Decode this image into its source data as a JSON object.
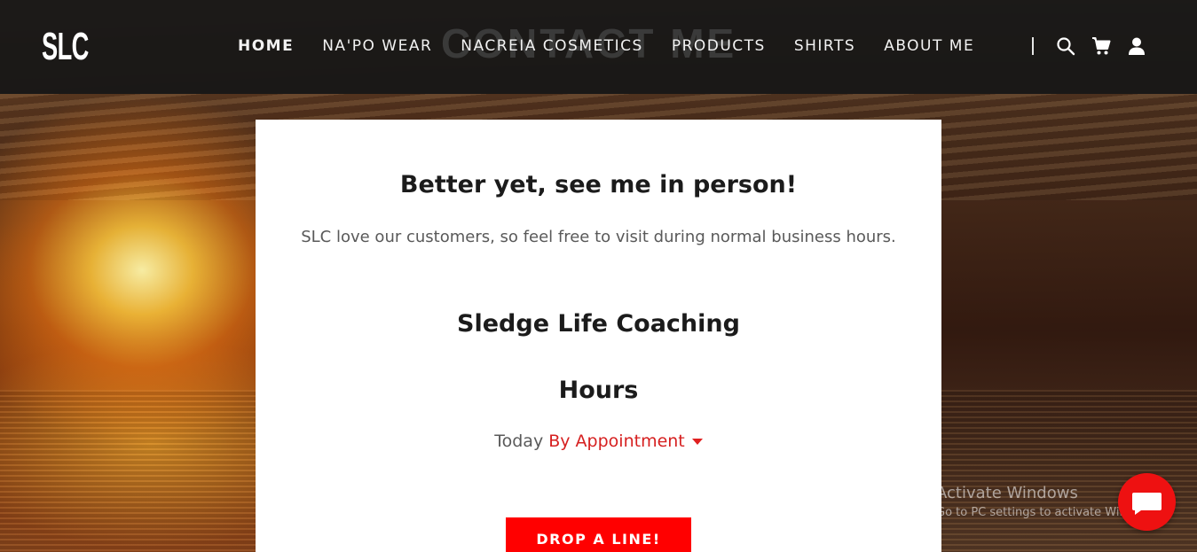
{
  "header": {
    "logo": "SLC",
    "ghost_title": "CONTACT ME",
    "nav": [
      {
        "label": "HOME",
        "active": true
      },
      {
        "label": "NA'PO WEAR",
        "active": false
      },
      {
        "label": "NACREIA COSMETICS",
        "active": false
      },
      {
        "label": "PRODUCTS",
        "active": false
      },
      {
        "label": "SHIRTS",
        "active": false
      },
      {
        "label": "ABOUT ME",
        "active": false
      }
    ],
    "icons": [
      "search-icon",
      "cart-icon",
      "user-icon"
    ]
  },
  "card": {
    "heading": "Better yet, see me in person!",
    "subtext": "SLC love our customers, so feel free to visit during normal business hours.",
    "business_name": "Sledge Life Coaching",
    "hours_title": "Hours",
    "hours_day": "Today",
    "hours_value": "By Appointment",
    "cta_label": "DROP A LINE!"
  },
  "watermark": {
    "title": "Activate Windows",
    "subtitle": "Go to PC settings to activate Windows."
  },
  "colors": {
    "header_bg": "#161616",
    "accent": "#ff0000",
    "link_red": "#d62020",
    "card_bg": "#ffffff"
  }
}
